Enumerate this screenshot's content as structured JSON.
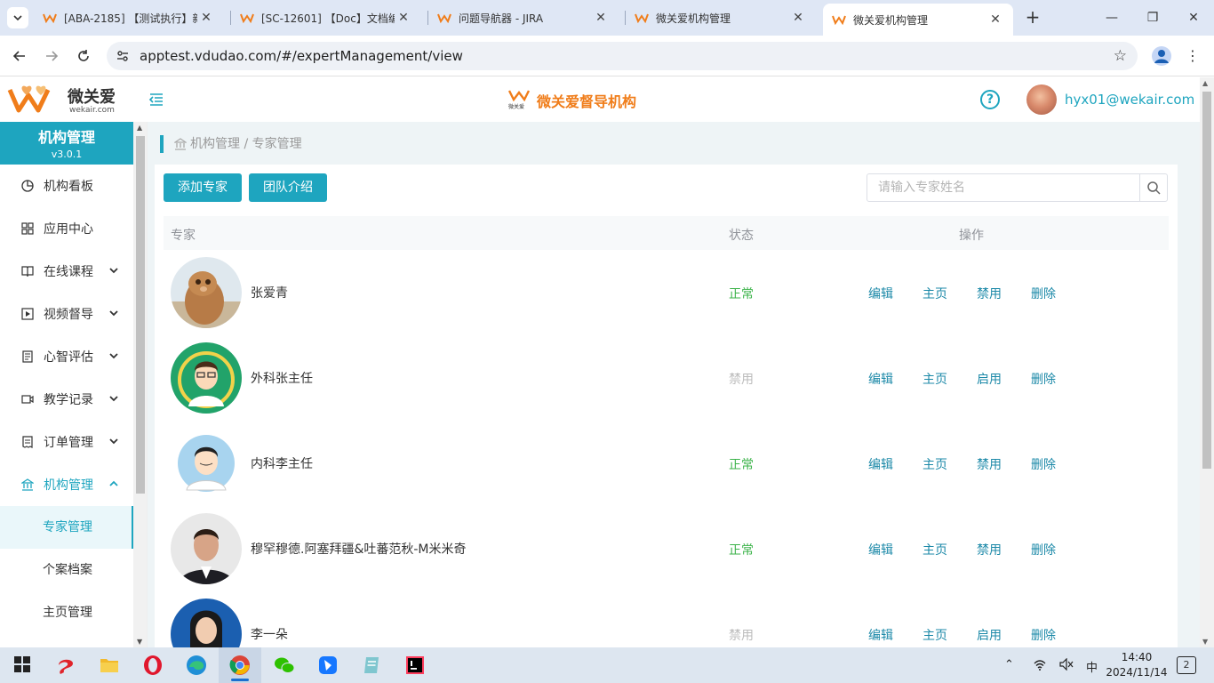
{
  "browser": {
    "tabs": [
      {
        "title": "[ABA-2185] 【测试执行】新"
      },
      {
        "title": "[SC-12601] 【Doc】文档编"
      },
      {
        "title": "问题导航器 - JIRA"
      },
      {
        "title": "微关爱机构管理"
      },
      {
        "title": "微关爱机构管理"
      }
    ],
    "url": "apptest.vdudao.com/#/expertManagement/view"
  },
  "header": {
    "logo_cn": "微关爱",
    "logo_en": "wekair.com",
    "center_title": "微关爱督导机构",
    "center_mini_logo": "微关爱",
    "help": "?",
    "user_email": "hyx01@wekair.com"
  },
  "sidebar": {
    "title": "机构管理",
    "version": "v3.0.1",
    "items": [
      {
        "label": "机构看板",
        "icon": "pie-chart-icon"
      },
      {
        "label": "应用中心",
        "icon": "grid-icon"
      },
      {
        "label": "在线课程",
        "icon": "book-icon"
      },
      {
        "label": "视频督导",
        "icon": "play-icon"
      },
      {
        "label": "心智评估",
        "icon": "document-icon"
      },
      {
        "label": "教学记录",
        "icon": "video-camera-icon"
      },
      {
        "label": "订单管理",
        "icon": "receipt-icon"
      },
      {
        "label": "机构管理",
        "icon": "bank-icon"
      }
    ],
    "sub_items": [
      {
        "label": "专家管理"
      },
      {
        "label": "个案档案"
      },
      {
        "label": "主页管理"
      }
    ]
  },
  "main": {
    "breadcrumb": "机构管理 / 专家管理",
    "add_button": "添加专家",
    "team_button": "团队介绍",
    "search_placeholder": "请输入专家姓名",
    "table": {
      "headers": [
        "专家",
        "状态",
        "操作"
      ],
      "rows": [
        {
          "name": "张爱青",
          "status": "正常",
          "ops": [
            "编辑",
            "主页",
            "禁用",
            "删除"
          ]
        },
        {
          "name": "外科张主任",
          "status": "禁用",
          "ops": [
            "编辑",
            "主页",
            "启用",
            "删除"
          ]
        },
        {
          "name": "内科李主任",
          "status": "正常",
          "ops": [
            "编辑",
            "主页",
            "禁用",
            "删除"
          ]
        },
        {
          "name": "穆罕穆德.阿塞拜疆&吐蕃范秋-M米米奇",
          "status": "正常",
          "ops": [
            "编辑",
            "主页",
            "禁用",
            "删除"
          ]
        },
        {
          "name": "李一朵",
          "status": "禁用",
          "ops": [
            "编辑",
            "主页",
            "启用",
            "删除"
          ]
        }
      ]
    }
  },
  "taskbar": {
    "ime": "中",
    "time": "14:40",
    "date": "2024/11/14",
    "notifications": "2"
  },
  "colors": {
    "accent": "#1ea5bf",
    "brand_orange": "#f07d1a",
    "status_ok": "#3cb34a",
    "status_off": "#bbbbbb",
    "link": "#1c89a8"
  }
}
